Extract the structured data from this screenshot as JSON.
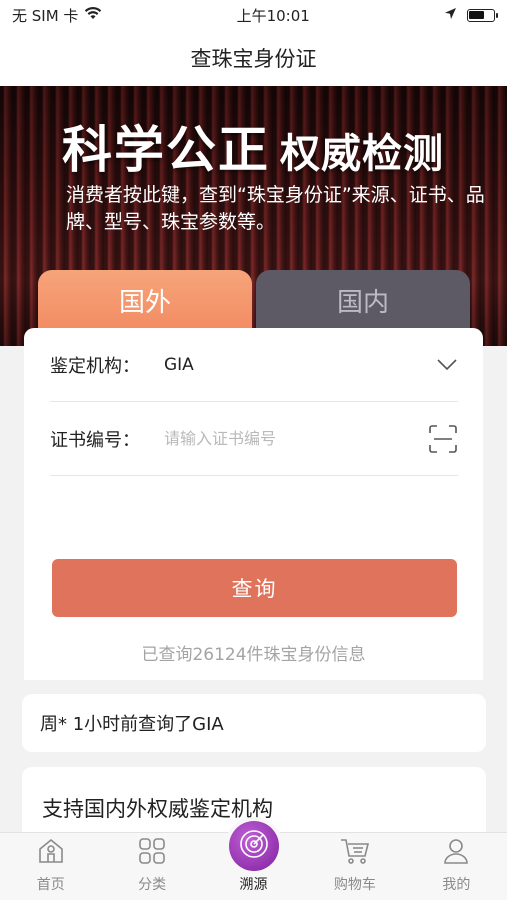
{
  "status_bar": {
    "carrier": "无 SIM 卡",
    "time": "上午10:01",
    "battery_level": 0.65
  },
  "nav": {
    "title": "查珠宝身份证"
  },
  "banner": {
    "title_big": "科学公正",
    "title_small": "权威检测",
    "description": "消费者按此键，查到“珠宝身份证”来源、证书、品牌、型号、珠宝参数等。"
  },
  "tabs": [
    {
      "label": "国外",
      "active": true
    },
    {
      "label": "国内",
      "active": false
    }
  ],
  "form": {
    "org_label": "鉴定机构：",
    "org_value": "GIA",
    "cert_label": "证书编号：",
    "cert_value": "",
    "cert_placeholder": "请输入证书编号",
    "submit_label": "查询",
    "count_text": "已查询26124件珠宝身份信息"
  },
  "notice": {
    "text": "周* 1小时前查询了GIA"
  },
  "support": {
    "title": "支持国内外权威鉴定机构"
  },
  "tab_bar": {
    "items": [
      {
        "label": "首页",
        "icon": "home-icon"
      },
      {
        "label": "分类",
        "icon": "grid-icon"
      },
      {
        "label": "溯源",
        "icon": "radar-icon"
      },
      {
        "label": "购物车",
        "icon": "cart-icon"
      },
      {
        "label": "我的",
        "icon": "user-icon"
      }
    ]
  },
  "colors": {
    "accent": "#e0735b",
    "tab_active": "#f28a61",
    "tab_inactive": "#5d5a66",
    "center_icon": "#9b30bb"
  }
}
